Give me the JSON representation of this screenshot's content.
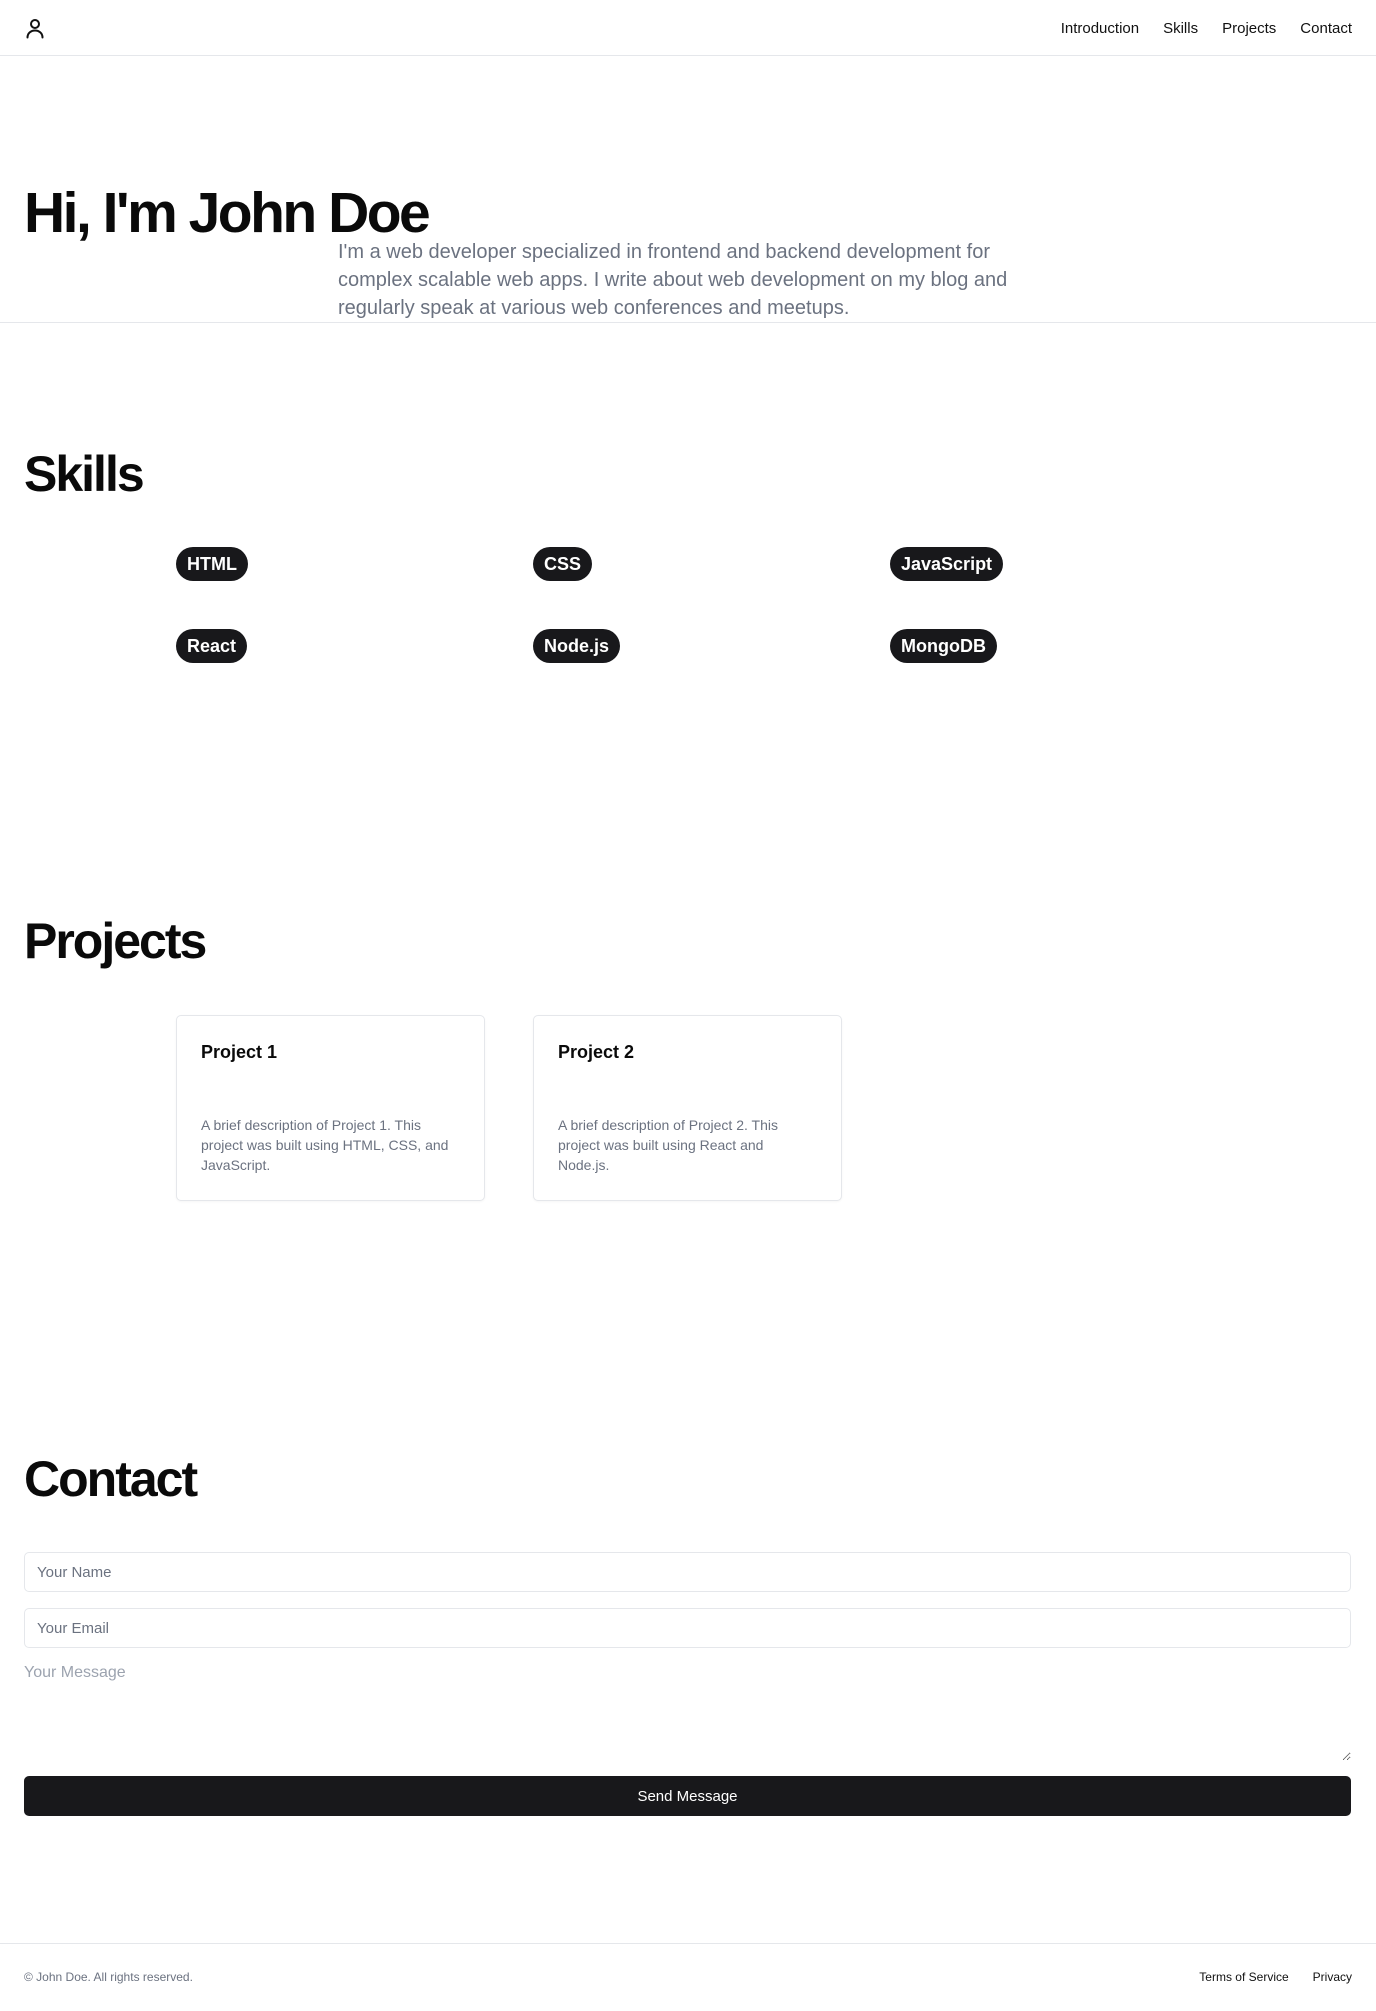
{
  "header": {
    "logo_icon": "user-icon",
    "nav": [
      {
        "label": "Introduction"
      },
      {
        "label": "Skills"
      },
      {
        "label": "Projects"
      },
      {
        "label": "Contact"
      }
    ]
  },
  "hero": {
    "title": "Hi, I'm John Doe",
    "description": "I'm a web developer specialized in frontend and backend development for complex scalable web apps. I write about web development on my blog and regularly speak at various web conferences and meetups."
  },
  "skills": {
    "title": "Skills",
    "items": [
      "HTML",
      "CSS",
      "JavaScript",
      "React",
      "Node.js",
      "MongoDB"
    ]
  },
  "projects": {
    "title": "Projects",
    "items": [
      {
        "title": "Project 1",
        "description": "A brief description of Project 1. This project was built using HTML, CSS, and JavaScript."
      },
      {
        "title": "Project 2",
        "description": "A brief description of Project 2. This project was built using React and Node.js."
      }
    ]
  },
  "contact": {
    "title": "Contact",
    "name_placeholder": "Your Name",
    "email_placeholder": "Your Email",
    "message_placeholder": "Your Message",
    "send_label": "Send Message"
  },
  "footer": {
    "copyright": "© John Doe. All rights reserved.",
    "links": [
      {
        "label": "Terms of Service"
      },
      {
        "label": "Privacy"
      }
    ]
  },
  "colors": {
    "primary": "#18181b",
    "muted_text": "#6b7280",
    "border": "#e5e7eb"
  }
}
